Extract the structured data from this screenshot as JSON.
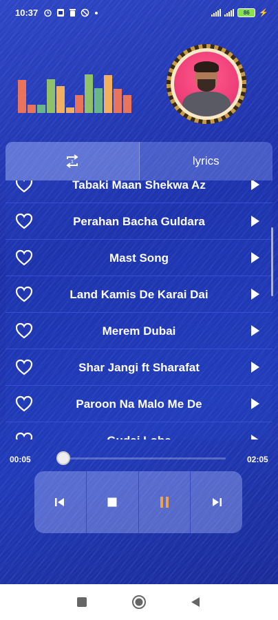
{
  "status_bar": {
    "time": "10:37",
    "icons": [
      "alarm-icon",
      "gallery-icon",
      "delete-icon",
      "sync-off-icon",
      "dot-icon"
    ],
    "battery": "86"
  },
  "equalizer": {
    "bars": [
      {
        "level": 0.82,
        "color": "#e8745c"
      },
      {
        "level": 0.2,
        "color": "#e8745c"
      },
      {
        "level": 0.2,
        "color": "#6bb58a"
      },
      {
        "level": 0.84,
        "color": "#8fc06a"
      },
      {
        "level": 0.68,
        "color": "#f0b060"
      },
      {
        "level": 0.14,
        "color": "#f0b060"
      },
      {
        "level": 0.44,
        "color": "#e8745c"
      },
      {
        "level": 0.96,
        "color": "#8fc06a"
      },
      {
        "level": 0.62,
        "color": "#6bb58a"
      },
      {
        "level": 0.94,
        "color": "#f0b060"
      },
      {
        "level": 0.6,
        "color": "#e8745c"
      },
      {
        "level": 0.44,
        "color": "#e8745c"
      }
    ]
  },
  "tabs": [
    {
      "icon": "repeat-icon",
      "label": ""
    },
    {
      "label": "lyrics"
    }
  ],
  "songs": [
    "Tabaki Maan Shekwa Az",
    "Perahan Bacha Guldara",
    "Mast Song",
    "Land Kamis De Karai Dai",
    "Merem Dubai",
    "Shar Jangi ft Sharafat",
    "Paroon Na Malo Me De",
    "Gudai Lobe"
  ],
  "player": {
    "elapsed": "00:05",
    "duration": "02:05",
    "progress": 0.04
  },
  "colors": {
    "accent_pause": "#f0a050",
    "background": "#1c2fa8"
  },
  "controls": [
    "previous-icon",
    "stop-icon",
    "pause-icon",
    "next-icon"
  ],
  "nav_bar": [
    "recent-apps-icon",
    "home-icon",
    "back-icon"
  ]
}
